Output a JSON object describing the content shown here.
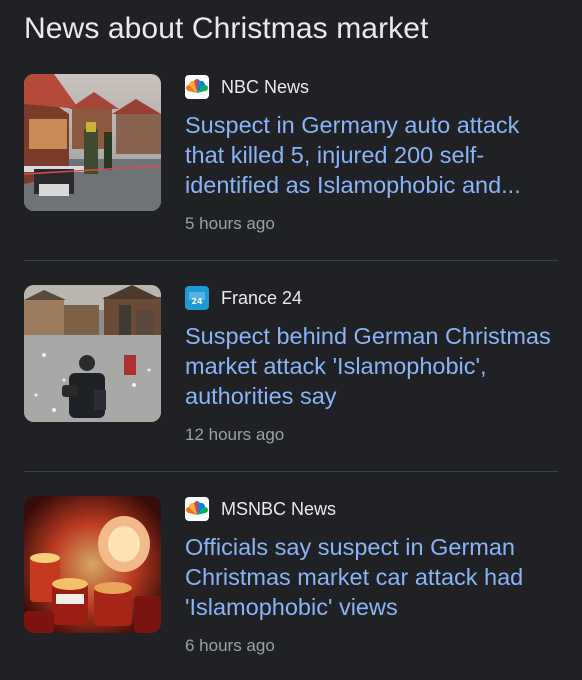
{
  "section": {
    "title": "News about Christmas market"
  },
  "articles": [
    {
      "source": "NBC News",
      "source_logo": "nbc-peacock-logo",
      "headline": "Suspect in Germany auto attack that killed 5, injured 200 self-identified as Islamophobic and...",
      "time": "5 hours ago",
      "thumbnail": "christmas-market-police-scene"
    },
    {
      "source": "France 24",
      "source_logo": "france24-logo",
      "headline": "Suspect behind German Christmas market attack 'Islamophobic', authorities say",
      "time": "12 hours ago",
      "thumbnail": "police-officer-market-street"
    },
    {
      "source": "MSNBC News",
      "source_logo": "nbc-peacock-logo",
      "headline": "Officials say suspect in German Christmas market car attack had 'Islamophobic' views",
      "time": "6 hours ago",
      "thumbnail": "memorial-candles"
    }
  ],
  "colors": {
    "background": "#202124",
    "title_text": "#e8eaed",
    "headline_link": "#8ab4f8",
    "meta_text": "#9aa0a6",
    "divider": "#3c4043"
  }
}
